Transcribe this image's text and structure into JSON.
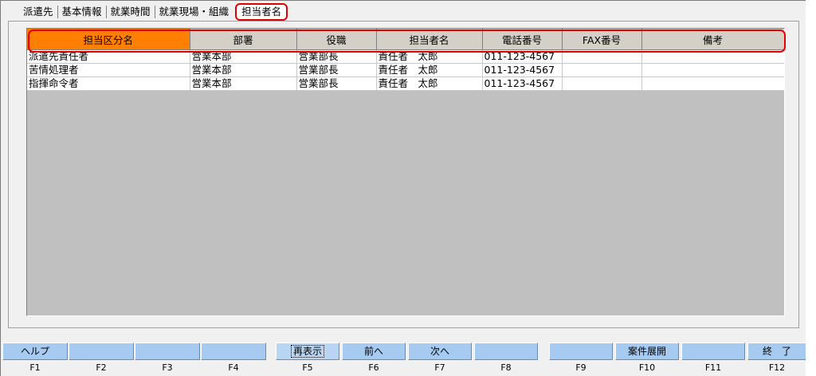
{
  "tabs": [
    {
      "label": "派遣先"
    },
    {
      "label": "基本情報"
    },
    {
      "label": "就業時間"
    },
    {
      "label": "就業現場・組織"
    },
    {
      "label": "担当者名",
      "active": true
    }
  ],
  "grid": {
    "headers": [
      "担当区分名",
      "部署",
      "役職",
      "担当者名",
      "電話番号",
      "FAX番号",
      "備考"
    ],
    "rows": [
      [
        "派遣先責任者",
        "営業本部",
        "営業部長",
        "責任者　太郎",
        "011-123-4567",
        "",
        ""
      ],
      [
        "苦情処理者",
        "営業本部",
        "営業部長",
        "責任者　太郎",
        "011-123-4567",
        "",
        ""
      ],
      [
        "指揮命令者",
        "営業本部",
        "営業部長",
        "責任者　太郎",
        "011-123-4567",
        "",
        ""
      ]
    ]
  },
  "fkeys": [
    {
      "label": "ヘルプ",
      "key": "F1"
    },
    {
      "label": "",
      "key": "F2"
    },
    {
      "label": "",
      "key": "F3"
    },
    {
      "label": "",
      "key": "F4"
    },
    {
      "label": "再表示",
      "key": "F5"
    },
    {
      "label": "前へ",
      "key": "F6"
    },
    {
      "label": "次へ",
      "key": "F7"
    },
    {
      "label": "",
      "key": "F8"
    },
    {
      "label": "",
      "key": "F9"
    },
    {
      "label": "案件展開",
      "key": "F10"
    },
    {
      "label": "",
      "key": "F11"
    },
    {
      "label": "終　了",
      "key": "F12"
    }
  ],
  "colors": {
    "highlight": "#e00000",
    "active_header": "#ff8000",
    "fkey_bg": "#a6caf0"
  }
}
